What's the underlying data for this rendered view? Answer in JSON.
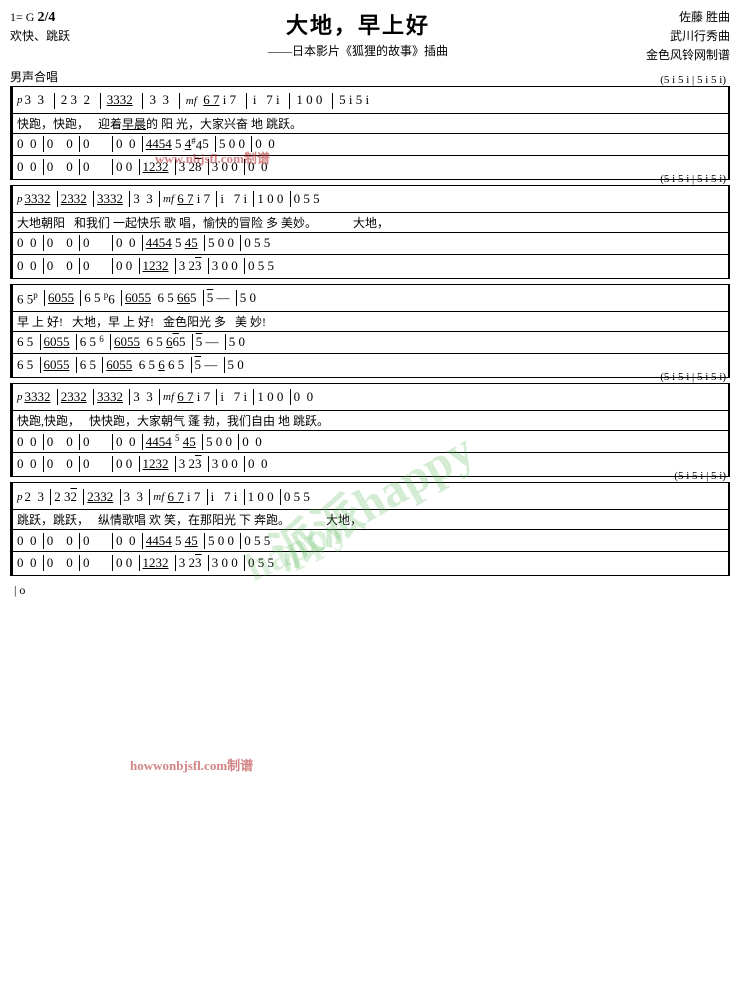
{
  "page": {
    "title": "大地，早上好",
    "key": "1= G",
    "time": "2/4",
    "tempo": "欢快、跳跃",
    "composer": "佐藤 胜曲",
    "arranger": "武川行秀曲",
    "source": "金色风铃网制谱",
    "subtitle": "——日本影片《狐狸的故事》插曲",
    "voice": "男声合唱"
  },
  "watermark": {
    "text1": "派派",
    "text2": "happy",
    "url1": "www.nbjsfl.com制谱",
    "url2": "howwonbjsfl.com制谱"
  },
  "sections": [
    {
      "id": "section1",
      "repeat_annotation": "(5 i 5 i | 5 i 5 i)",
      "rows": [
        {
          "type": "notation",
          "dynamic": "p",
          "content": "3  3  | 2 3  2 | 3 3 3 2 | 3  3 |  6 7 i 7 | i   7 i | 1 0 0 | 5 i 5 i"
        },
        {
          "type": "lyrics",
          "content": "快跑，快跑，   迎着早晨的  阳  光，大家兴奋 地  跳跃。"
        }
      ]
    }
  ]
}
